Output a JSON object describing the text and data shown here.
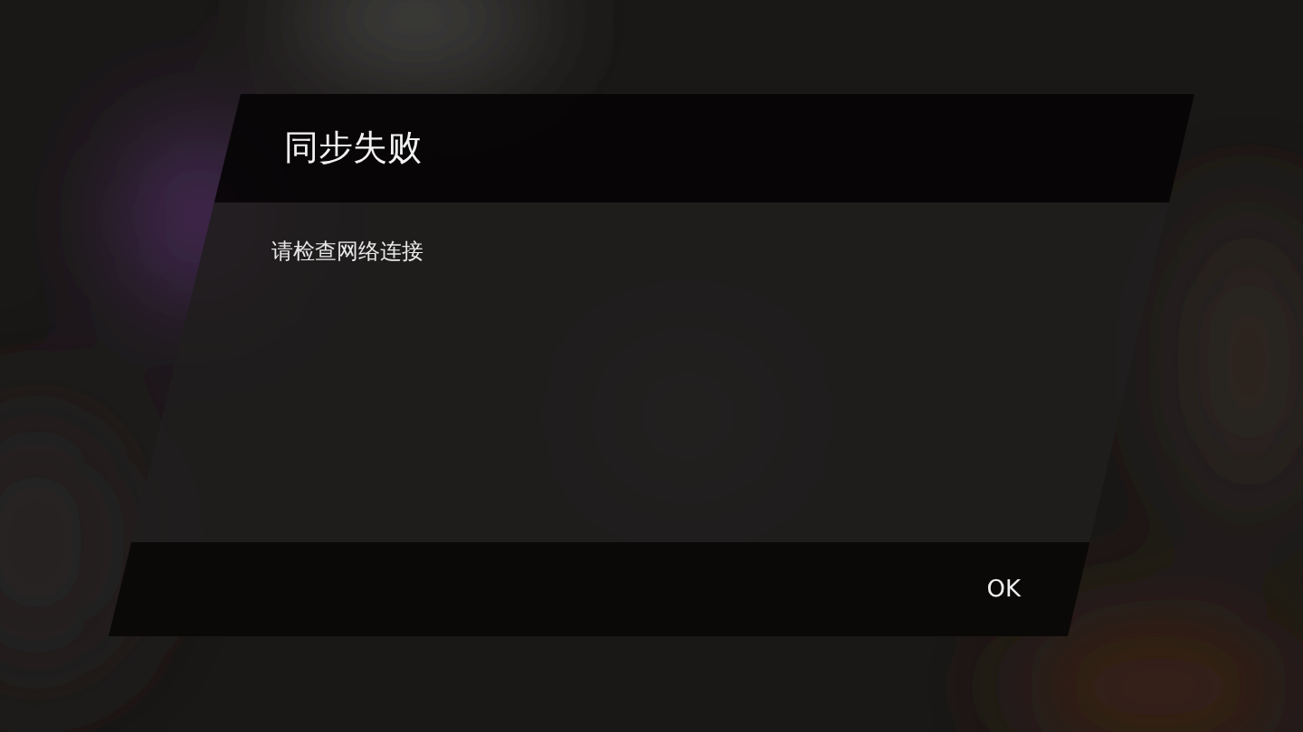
{
  "dialog": {
    "title": "同步失败",
    "message": "请检查网络连接",
    "buttons": [
      "OK"
    ]
  }
}
